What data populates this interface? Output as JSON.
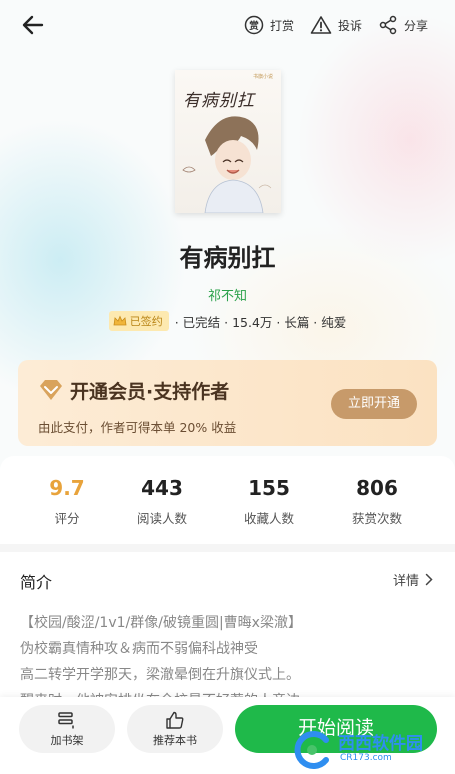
{
  "topbar": {
    "reward_label": "打赏",
    "reward_icon_glyph": "赏",
    "report_label": "投诉",
    "share_label": "分享"
  },
  "book": {
    "cover_title": "有病别扛",
    "cover_tag": "书旗小说",
    "title": "有病别扛",
    "author": "祁不知",
    "signed_badge": "已签约",
    "meta": "· 已完结 · 15.4万 · 长篇 · 纯爱"
  },
  "vip": {
    "title": "开通会员·支持作者",
    "subtitle": "由此支付，作者可得本单 20% 收益",
    "button": "立即开通"
  },
  "stats": [
    {
      "value": "9.7",
      "label": "评分",
      "color": "#e8a33b"
    },
    {
      "value": "443",
      "label": "阅读人数"
    },
    {
      "value": "155",
      "label": "收藏人数"
    },
    {
      "value": "806",
      "label": "获赏次数"
    }
  ],
  "intro": {
    "heading": "简介",
    "more": "详情",
    "lines": [
      "【校园/酸涩/1v1/群像/破镜重圆|曹晦x梁澈】",
      "伪校霸真情种攻＆病而不弱偏科战神受",
      "高二转学开学那天，梁澈晕倒在升旗仪式上。",
      "醒来时，他被安排坐在全校最不好惹的人旁边"
    ]
  },
  "bottom": {
    "shelf_label": "加书架",
    "recommend_label": "推荐本书",
    "read_label": "开始阅读"
  },
  "watermark": {
    "text": "西西软件园",
    "url": "CR173.com"
  },
  "colors": {
    "accent_green": "#1fb94a",
    "author_green": "#2aa14a",
    "vip_gold": "#c79a6a",
    "rating_orange": "#e8a33b"
  }
}
